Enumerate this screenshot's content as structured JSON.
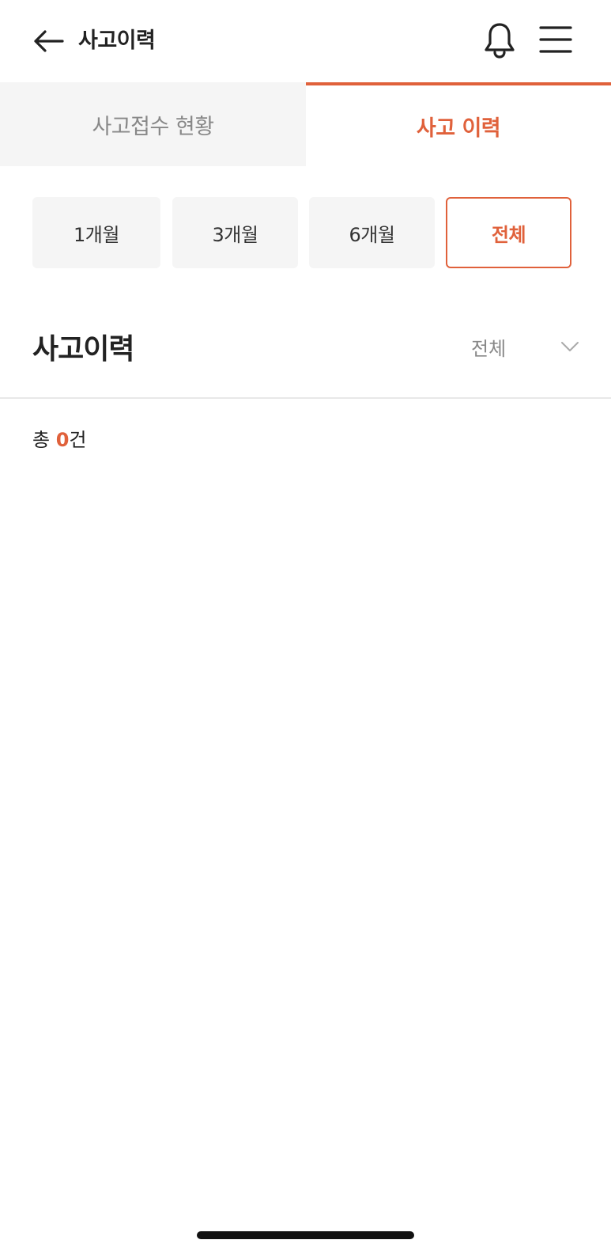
{
  "header": {
    "title": "사고이력",
    "back_icon": "arrow-left-icon",
    "bell_icon": "bell-icon",
    "menu_icon": "hamburger-menu-icon"
  },
  "tabs": [
    {
      "label": "사고접수 현황",
      "active": false
    },
    {
      "label": "사고 이력",
      "active": true
    }
  ],
  "period_filters": [
    {
      "label": "1개월",
      "selected": false
    },
    {
      "label": "3개월",
      "selected": false
    },
    {
      "label": "6개월",
      "selected": false
    },
    {
      "label": "전체",
      "selected": true
    }
  ],
  "section": {
    "title": "사고이력",
    "filter_value": "전체",
    "filter_icon": "chevron-down-icon"
  },
  "summary": {
    "prefix": "총 ",
    "count": "0",
    "suffix": "건"
  },
  "colors": {
    "accent": "#e0613b",
    "inactive_tab_bg": "#f5f5f5",
    "inactive_text": "#888888",
    "text": "#222222"
  }
}
